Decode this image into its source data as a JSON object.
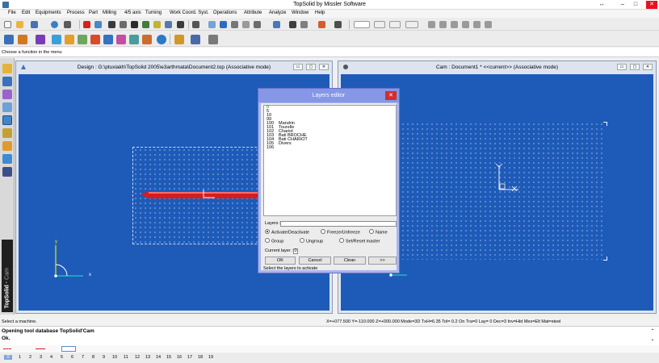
{
  "window": {
    "title": "TopSolid by Missler Software"
  },
  "menu": [
    "File",
    "Edit",
    "Equipments",
    "Process",
    "Part",
    "Milling",
    "4/5 axis",
    "Turning",
    "Work Coord. Syst.",
    "Operations",
    "Attribute",
    "Analyze",
    "Window",
    "Help"
  ],
  "hint": "Choose a function in the menu",
  "brand": {
    "name": "TopSolid",
    "module": "Cam"
  },
  "design_window": {
    "title": "Design : G:\\ptuxiakh\\TopSolid 2005\\e3arthmata\\Document2.top (Associative mode)"
  },
  "cam_window": {
    "title": "Cam : Document1 * <<current>> (Associative mode)"
  },
  "axes": {
    "x": "x",
    "y": "y"
  },
  "layers_dialog": {
    "title": "Layers editor",
    "layers": [
      {
        "num": "0",
        "name": ""
      },
      {
        "num": "5",
        "name": ""
      },
      {
        "num": "10",
        "name": ""
      },
      {
        "num": "99",
        "name": ""
      },
      {
        "num": "100",
        "name": "Mandrin"
      },
      {
        "num": "101",
        "name": "Tourelle"
      },
      {
        "num": "102",
        "name": "Chariot"
      },
      {
        "num": "103",
        "name": "Bati BROCHE"
      },
      {
        "num": "104",
        "name": "Bati CHARIOT"
      },
      {
        "num": "105",
        "name": "Divers"
      },
      {
        "num": "106",
        "name": ""
      }
    ],
    "layers_label": "Layers :",
    "radios": [
      {
        "label": "Activate/Deactivate",
        "checked": true
      },
      {
        "label": "Freeze/Unfreeze",
        "checked": false
      },
      {
        "label": "Name",
        "checked": false
      },
      {
        "label": "Group",
        "checked": false
      },
      {
        "label": "Ungroup",
        "checked": false
      },
      {
        "label": "Set/Reset master",
        "checked": false
      }
    ],
    "current_layer_label": "Current layer :",
    "current_layer_value": "0",
    "buttons": {
      "ok": "OK",
      "cancel": "Cancel",
      "clean": "Clean",
      "more": ">>"
    },
    "status": "Select the layers to activate"
  },
  "status": {
    "message": "Select a machine.",
    "coords": "X=+077.500  Y=-110.000  Z=+000.000  Mode=3D  TxH=6.35  Tol=  0.2   On  Tra=0   Lay=  0   Dec=3   Inv=Hid  Mes=Elt  Mat=steel"
  },
  "output": {
    "line1": "Opening tool database TopSolid'Cam",
    "line2": "Ok."
  },
  "pages": [
    "0",
    "1",
    "2",
    "3",
    "4",
    "5",
    "6",
    "7",
    "8",
    "9",
    "10",
    "11",
    "12",
    "13",
    "14",
    "15",
    "16",
    "17",
    "18",
    "19"
  ],
  "colors": {
    "viewport": "#1e5bb8",
    "dialog_frame": "#a8b7ec",
    "dialog_title": "#8597e6",
    "tool": "#d41d1d"
  }
}
